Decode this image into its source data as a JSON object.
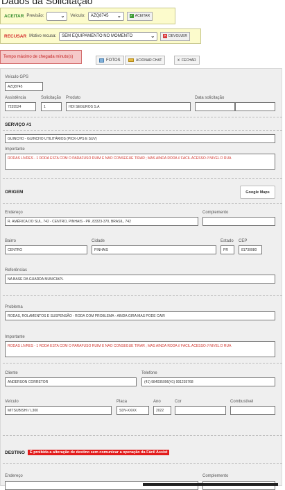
{
  "page_title": "Dados da Solicitação",
  "accept_bar": {
    "label": "ACEITAR",
    "previsao_label": "Previsão:",
    "previsao_value": "",
    "veiculo_label": "Veículo:",
    "veiculo_value": "AZQ8745",
    "button_label": "ACEITAR"
  },
  "refuse_bar": {
    "label": "RECUSAR",
    "motivo_label": "Motivo recusa:",
    "motivo_value": "SEM EQUIPAMENTO NO MOMENTO",
    "button_label": "DEVOLVER"
  },
  "time_warning": "Tempo máximo de chegada minuto(s)",
  "toolbar": {
    "fotos": "FOTOS",
    "acionar_chat": "ACIONAR CHAT",
    "fechar": "FECHAR"
  },
  "veiculo_gps": {
    "label": "Veículo GPS",
    "value": "AZQ8745"
  },
  "assistencia": {
    "label": "Assistência",
    "value": "7235524"
  },
  "solicitacao": {
    "label": "Solicitação",
    "value": "1"
  },
  "produto": {
    "label": "Produto",
    "value": "HDI SEGUROS S.A"
  },
  "data_solicitacao": {
    "label": "Data solicitação",
    "value": "",
    "value2": ""
  },
  "servico": {
    "title": "SERVIÇO #1",
    "tipo": "GUINCHO - GUINCHO UTILITÁRIOS (PICK-UPS E SUV)",
    "importante_label": "Importante",
    "importante": "RODAS LIVRES - 1 RODA ESTA COM O PARAFUSO RUIM E NAO CONSEGUE TIRAR ; MAS AINDA RODA // FACIL ACESSO // NIVEL D RUA"
  },
  "origem": {
    "title": "ORIGEM",
    "maps_button": "Google Maps",
    "endereco_label": "Endereço",
    "endereco": "R. AMÉRICA DO SUL, 742 - CENTRO, PINHAIS - PR, 83323-370, BRASIL, 742",
    "complemento_label": "Complemento",
    "complemento": "",
    "bairro_label": "Bairro",
    "bairro": "CENTRO",
    "cidade_label": "Cidade",
    "cidade": "PINHAIS",
    "estado_label": "Estado",
    "estado": "PR",
    "cep_label": "CEP",
    "cep": "81730080",
    "referencias_label": "Referências",
    "referencias": "NA BASE DA GUARDA MUNICIAPL"
  },
  "problema": {
    "label": "Problema",
    "value": "RODAS, ROLAMENTOS E SUSPENSÃO - RODA COM PROBLEMA - AINDA GIRA MAS PODE CAIR",
    "importante_label": "Importante",
    "importante": "RODAS LIVRES - 1 RODA ESTA COM O PARAFUSO RUIM E NAO CONSEGUE TIRAR ; MAS AINDA RODA // FACIL ACESSO // NIVEL D RUA"
  },
  "cliente": {
    "label": "Cliente",
    "value": "ANDERSON CORRETOR"
  },
  "telefone": {
    "label": "Telefone",
    "value": "(41) 984035096(41) 991235768"
  },
  "veiculo": {
    "label": "Veículo",
    "value": "MITSUBISHI / L300",
    "placa_label": "Placa",
    "placa": "SDV-XXXX",
    "ano_label": "Ano",
    "ano": "2022",
    "cor_label": "Cor",
    "cor": "",
    "combustivel_label": "Combustível",
    "combustivel": ""
  },
  "destino": {
    "title": "DESTINO",
    "warning": "É proibida a alteração de destino sem comunicar a operação da Fácil Assist",
    "endereco_label": "Endereço",
    "complemento_label": "Complemento"
  }
}
